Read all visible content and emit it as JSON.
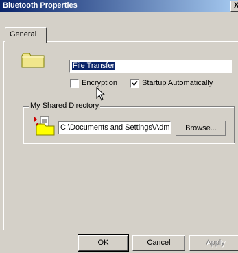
{
  "window": {
    "title": "Bluetooth Properties",
    "close_glyph": "X"
  },
  "tabs": [
    {
      "label": "General"
    }
  ],
  "general": {
    "service_name": "File Transfer",
    "encryption_label": "Encryption",
    "encryption_checked": false,
    "startup_label": "Startup Automatically",
    "startup_checked": true,
    "shared_dir_group_label": "My Shared Directory",
    "shared_dir_path": "C:\\Documents and Settings\\Adm",
    "browse_label": "Browse..."
  },
  "footer": {
    "ok_label": "OK",
    "cancel_label": "Cancel",
    "apply_label": "Apply"
  },
  "icons": {
    "service": "folder-icon",
    "shared": "shared-folder-icon",
    "cursor": "mouse-cursor-icon"
  }
}
